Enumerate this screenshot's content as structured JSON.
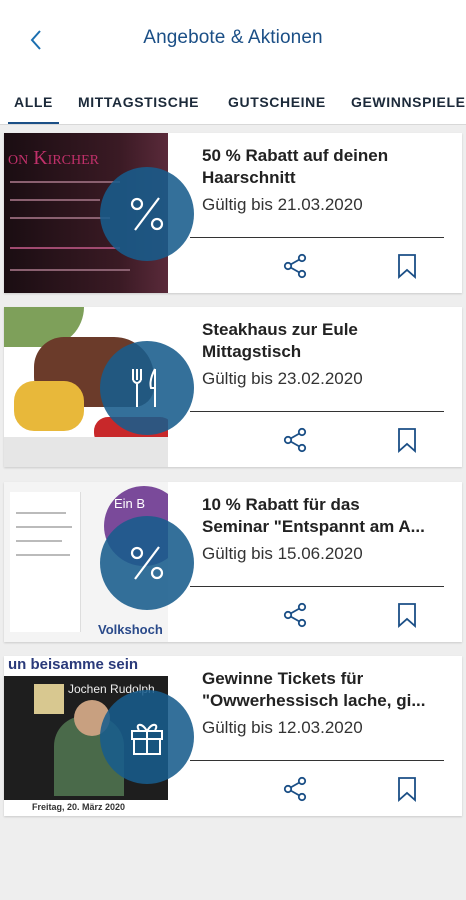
{
  "header": {
    "title": "Angebote & Aktionen",
    "back_icon": "chevron-left-icon"
  },
  "tabs": [
    {
      "label": "ALLE",
      "active": true
    },
    {
      "label": "MITTAGSTISCHE"
    },
    {
      "label": "GUTSCHEINE"
    },
    {
      "label": "GEWINNSPIELE"
    }
  ],
  "offers": [
    {
      "title_line1": "50 % Rabatt auf deinen",
      "title_line2": "Haarschnitt",
      "valid": "Gültig bis 21.03.2020",
      "badge_icon": "percent-icon",
      "image_text": "on Kircher"
    },
    {
      "title_line1": "Steakhaus zur Eule",
      "title_line2": "Mittagstisch",
      "valid": "Gültig bis 23.02.2020",
      "badge_icon": "fork-knife-icon"
    },
    {
      "title_line1": "10 % Rabatt für das",
      "title_line2": "Seminar \"Entspannt am A...",
      "valid": "Gültig bis 15.06.2020",
      "badge_icon": "percent-icon",
      "image_text": "Volkshoch",
      "image_text2": "Ein B"
    },
    {
      "title_line1": "Gewinne Tickets für",
      "title_line2": "\"Owwerhessisch lache, gi...",
      "valid": "Gültig bis 12.03.2020",
      "badge_icon": "gift-icon",
      "image_text": "un beisamme sein",
      "image_text2": "Jochen Rudolph",
      "image_text3": "Freitag, 20. März 2020"
    }
  ],
  "colors": {
    "accent": "#1b4f86",
    "badge": "#185c8c",
    "background": "#eeeeee"
  }
}
